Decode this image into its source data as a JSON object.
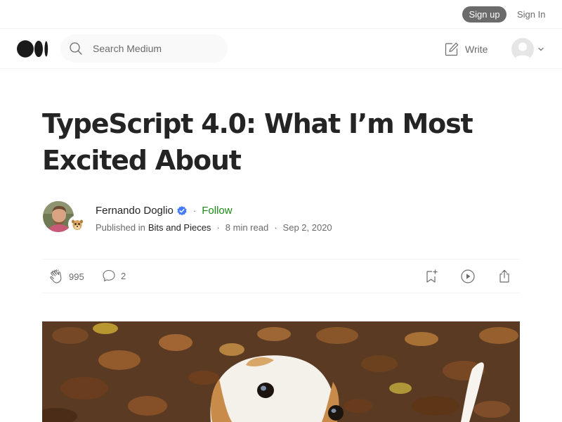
{
  "topbar": {
    "signup_label": "Sign up",
    "signin_label": "Sign In"
  },
  "header": {
    "logo_icon": "medium-logo-icon",
    "search": {
      "placeholder": "Search Medium",
      "value": ""
    },
    "write_label": "Write",
    "write_icon": "write-icon"
  },
  "article": {
    "title_line1": "TypeScript 4.0: What I’m Most",
    "title_line2": "Excited About",
    "author": {
      "name": "Fernando Doglio",
      "verified_icon": "verified-badge-icon",
      "follow_label": "Follow",
      "separator": "·"
    },
    "publication": {
      "prefix": "Published in",
      "name": "Bits and Pieces",
      "read_time": "8 min read",
      "date": "Sep 2, 2020",
      "separator": "·"
    },
    "actions": {
      "claps": "995",
      "responses": "2",
      "icons": [
        "clap-icon",
        "comment-icon",
        "save-icon",
        "listen-icon",
        "share-icon"
      ]
    }
  },
  "colors": {
    "text": "#242424",
    "muted": "#6b6b6b",
    "follow_green": "#1a8917",
    "signup_bg": "#6b6b6b",
    "verified_blue": "#437aff",
    "divider": "#f2f2f2"
  }
}
